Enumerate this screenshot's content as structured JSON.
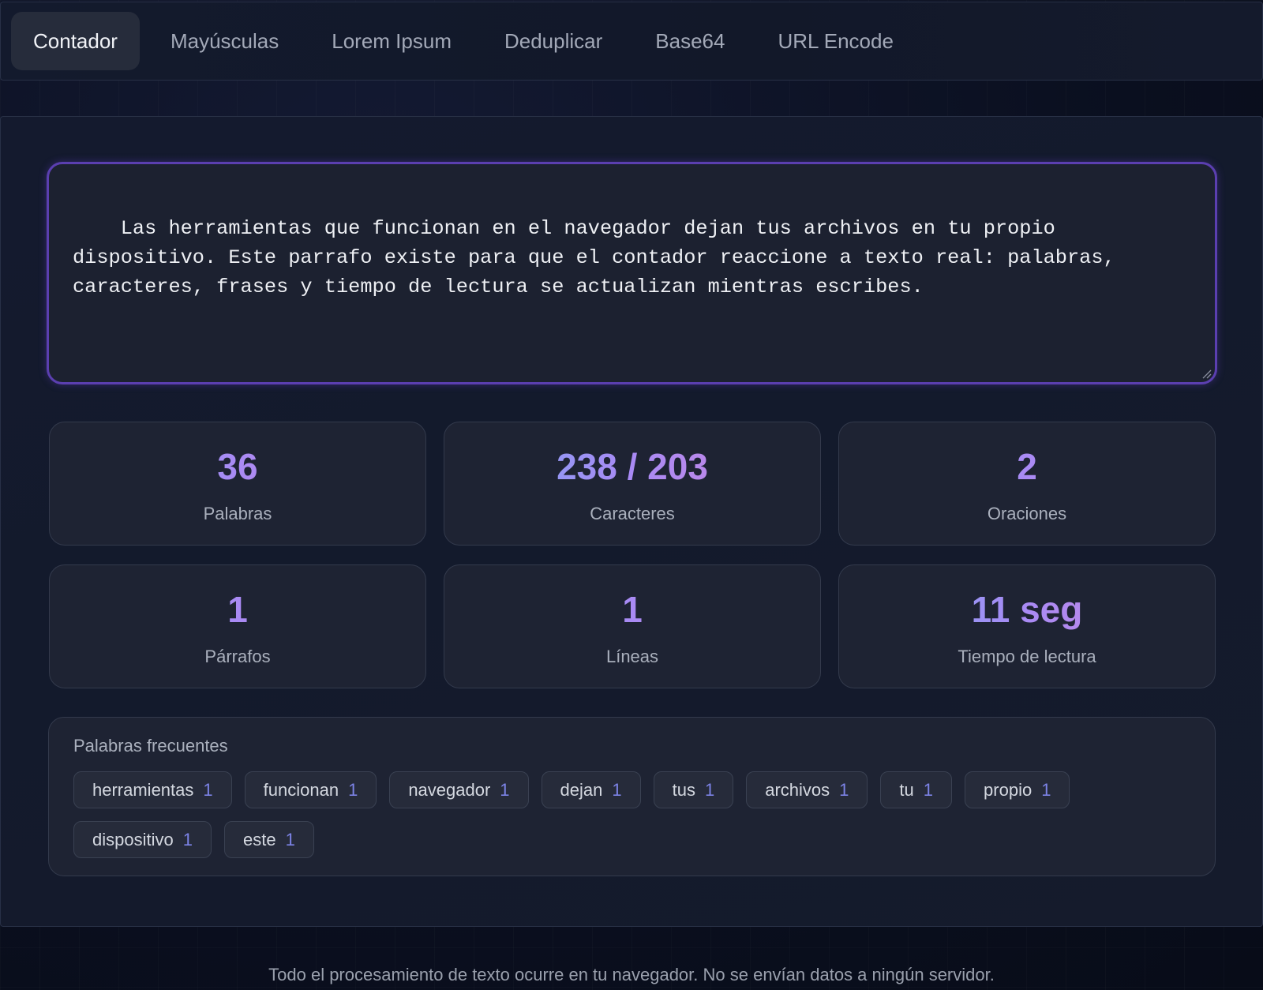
{
  "tabs": [
    {
      "label": "Contador",
      "active": true
    },
    {
      "label": "Mayúsculas",
      "active": false
    },
    {
      "label": "Lorem Ipsum",
      "active": false
    },
    {
      "label": "Deduplicar",
      "active": false
    },
    {
      "label": "Base64",
      "active": false
    },
    {
      "label": "URL Encode",
      "active": false
    }
  ],
  "editor": {
    "text": "Las herramientas que funcionan en el navegador dejan tus archivos en tu propio dispositivo. Este parrafo existe para que el contador reaccione a texto real: palabras, caracteres, frases y tiempo de lectura se actualizan mientras escribes."
  },
  "stats": {
    "words": {
      "value": "36",
      "label": "Palabras"
    },
    "chars": {
      "value": "238 / 203",
      "label": "Caracteres"
    },
    "sentences": {
      "value": "2",
      "label": "Oraciones"
    },
    "paragraphs": {
      "value": "1",
      "label": "Párrafos"
    },
    "lines": {
      "value": "1",
      "label": "Líneas"
    },
    "reading_time": {
      "value": "11 seg",
      "label": "Tiempo de lectura"
    }
  },
  "frequent": {
    "title": "Palabras frecuentes",
    "words": [
      {
        "word": "herramientas",
        "count": "1"
      },
      {
        "word": "funcionan",
        "count": "1"
      },
      {
        "word": "navegador",
        "count": "1"
      },
      {
        "word": "dejan",
        "count": "1"
      },
      {
        "word": "tus",
        "count": "1"
      },
      {
        "word": "archivos",
        "count": "1"
      },
      {
        "word": "tu",
        "count": "1"
      },
      {
        "word": "propio",
        "count": "1"
      },
      {
        "word": "dispositivo",
        "count": "1"
      },
      {
        "word": "este",
        "count": "1"
      }
    ]
  },
  "footer": {
    "text": "Todo el procesamiento de texto ocurre en tu navegador. No se envían datos a ningún servidor."
  },
  "colors": {
    "accent_border": "#5b3fb0",
    "gradient_start": "#7aa7f5",
    "gradient_mid": "#a98af4",
    "gradient_end": "#cf86dd",
    "chip_count": "#7c83e6"
  }
}
